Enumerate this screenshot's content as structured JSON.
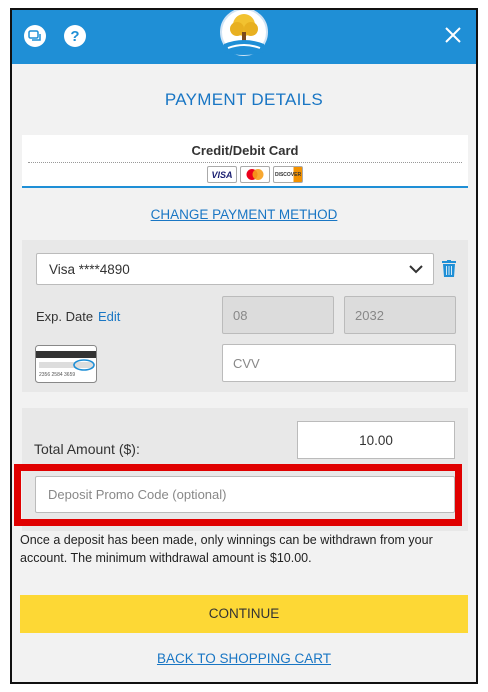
{
  "header": {
    "chat_icon": "chat-icon",
    "help_label": "?",
    "logo_icon": "tree-logo-icon",
    "close_icon": "close-icon"
  },
  "title": "PAYMENT DETAILS",
  "method": {
    "name": "Credit/Debit Card",
    "card_brands": [
      "VISA",
      "MasterCard",
      "DISCOVER"
    ]
  },
  "change_method_label": "CHANGE PAYMENT METHOD",
  "saved_card": {
    "selected": "Visa ****4890",
    "exp_label": "Exp. Date",
    "edit_label": "Edit",
    "exp_month": "08",
    "exp_year": "2032",
    "cvv_placeholder": "CVV",
    "cvv_card_sample": "2356 2584 3659"
  },
  "amount": {
    "label": "Total Amount ($):",
    "value": "10.00"
  },
  "promo": {
    "placeholder": "Deposit Promo Code (optional)"
  },
  "notice": "Once a deposit has been made, only winnings can be withdrawn from your account. The minimum withdrawal amount is $10.00.",
  "continue_label": "CONTINUE",
  "back_label": "BACK TO SHOPPING CART",
  "colors": {
    "header": "#1f8fd6",
    "link": "#1976c4",
    "button": "#fdd835",
    "highlight": "#e00000"
  }
}
